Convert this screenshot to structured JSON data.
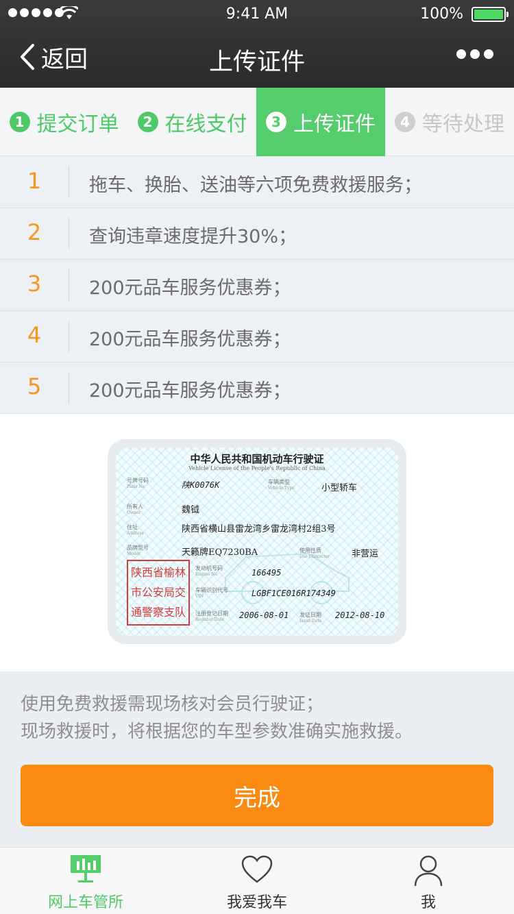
{
  "status_bar": {
    "time": "9:41 AM",
    "battery_percent": "100%",
    "battery_level": 1.0
  },
  "nav": {
    "back_label": "返回",
    "title": "上传证件",
    "more_icon": "ellipsis-icon"
  },
  "steps": [
    {
      "num": "1",
      "label": "提交订单",
      "state": "done"
    },
    {
      "num": "2",
      "label": "在线支付",
      "state": "done"
    },
    {
      "num": "3",
      "label": "上传证件",
      "state": "active"
    },
    {
      "num": "4",
      "label": "等待处理",
      "state": "pending"
    }
  ],
  "benefits": [
    {
      "index": "1",
      "text": "拖车、换胎、送油等六项免费救援服务；"
    },
    {
      "index": "2",
      "text": "查询违章速度提升30%；"
    },
    {
      "index": "3",
      "text": "200元品车服务优惠券；"
    },
    {
      "index": "4",
      "text": "200元品车服务优惠券；"
    },
    {
      "index": "5",
      "text": "200元品车服务优惠券；"
    }
  ],
  "license": {
    "title": "中华人民共和国机动车行驶证",
    "subtitle": "Vehicle License of the People's Republic of China",
    "plate_label": "号牌号码",
    "plate_label_en": "Plate No",
    "plate_value": "陕K0076K",
    "type_label": "车辆类型",
    "type_label_en": "Vehicle Type",
    "type_value": "小型轿车",
    "owner_label": "所有人",
    "owner_label_en": "Owner",
    "owner_value": "魏钺",
    "address_label": "住址",
    "address_label_en": "Address",
    "address_value": "陕西省横山县雷龙湾乡雷龙湾村2组3号",
    "model_label": "品牌型号",
    "model_label_en": "Model",
    "model_value": "天籁牌EQ7230BA",
    "use_label": "使用性质",
    "use_label_en": "Use Character",
    "use_value": "非营运",
    "engine_label": "发动机号码",
    "engine_label_en": "Engine No",
    "engine_value": "166495",
    "vin_label": "车辆识别代号",
    "vin_label_en": "VIN",
    "vin_value": "LGBF1CE016R174349",
    "register_label": "注册登记日期",
    "register_label_en": "Register Date",
    "register_value": "2006-08-01",
    "issue_label": "发证日期",
    "issue_label_en": "Issue Date",
    "issue_value": "2012-08-10",
    "stamp_lines": [
      "陕西省榆林",
      "市公安局交",
      "通警察支队"
    ]
  },
  "note": {
    "line1": "使用免费救援需现场核对会员行驶证；",
    "line2": "现场救援时，将根据您的车型参数准确实施救援。"
  },
  "finish_button": "完成",
  "tabbar": [
    {
      "label": "网上车管所",
      "icon": "chart-board-icon",
      "active": true
    },
    {
      "label": "我爱我车",
      "icon": "heart-icon",
      "active": false
    },
    {
      "label": "我",
      "icon": "user-icon",
      "active": false
    }
  ],
  "colors": {
    "accent_green": "#55cd6c",
    "accent_orange": "#fa8a12",
    "number_orange": "#f7961c",
    "stamp_red": "#d43b3b"
  }
}
